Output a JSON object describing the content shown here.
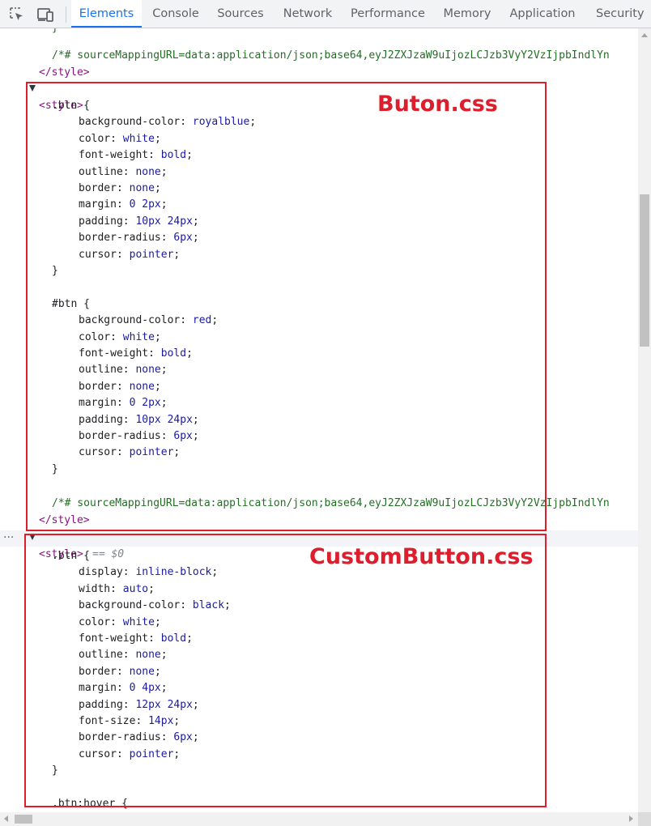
{
  "toolbar": {
    "inspect_icon": "inspect-element-icon",
    "device_icon": "device-toolbar-icon",
    "tabs": [
      {
        "label": "Elements",
        "active": true
      },
      {
        "label": "Console",
        "active": false
      },
      {
        "label": "Sources",
        "active": false
      },
      {
        "label": "Network",
        "active": false
      },
      {
        "label": "Performance",
        "active": false
      },
      {
        "label": "Memory",
        "active": false
      },
      {
        "label": "Application",
        "active": false
      },
      {
        "label": "Security",
        "active": false
      }
    ]
  },
  "tree": {
    "partial_brace": "}",
    "source_map_comment": "/*# sourceMappingURL=data:application/json;base64,eyJ2ZXJzaW9uIjozLCJzb3VyY2VzIjpbIndlYn",
    "style_open": "<style>",
    "style_close": "</style>",
    "selected_marker": "== $0",
    "style_block_1": [
      {
        "sel": ".btn {"
      },
      {
        "prop": "background-color",
        "val": "royalblue"
      },
      {
        "prop": "color",
        "val": "white"
      },
      {
        "prop": "font-weight",
        "val": "bold"
      },
      {
        "prop": "outline",
        "val": "none"
      },
      {
        "prop": "border",
        "val": "none"
      },
      {
        "prop": "margin",
        "val": "0 2px"
      },
      {
        "prop": "padding",
        "val": "10px 24px"
      },
      {
        "prop": "border-radius",
        "val": "6px"
      },
      {
        "prop": "cursor",
        "val": "pointer"
      },
      {
        "close": "}"
      },
      {
        "blank": true
      },
      {
        "sel": "#btn {"
      },
      {
        "prop": "background-color",
        "val": "red"
      },
      {
        "prop": "color",
        "val": "white"
      },
      {
        "prop": "font-weight",
        "val": "bold"
      },
      {
        "prop": "outline",
        "val": "none"
      },
      {
        "prop": "border",
        "val": "none"
      },
      {
        "prop": "margin",
        "val": "0 2px"
      },
      {
        "prop": "padding",
        "val": "10px 24px"
      },
      {
        "prop": "border-radius",
        "val": "6px"
      },
      {
        "prop": "cursor",
        "val": "pointer"
      },
      {
        "close": "}"
      },
      {
        "blank": true
      }
    ],
    "style_block_2": [
      {
        "sel": ".btn {"
      },
      {
        "prop": "display",
        "val": "inline-block"
      },
      {
        "prop": "width",
        "val": "auto"
      },
      {
        "prop": "background-color",
        "val": "black"
      },
      {
        "prop": "color",
        "val": "white"
      },
      {
        "prop": "font-weight",
        "val": "bold"
      },
      {
        "prop": "outline",
        "val": "none"
      },
      {
        "prop": "border",
        "val": "none"
      },
      {
        "prop": "margin",
        "val": "0 4px"
      },
      {
        "prop": "padding",
        "val": "12px 24px"
      },
      {
        "prop": "font-size",
        "val": "14px"
      },
      {
        "prop": "border-radius",
        "val": "6px"
      },
      {
        "prop": "cursor",
        "val": "pointer"
      },
      {
        "close": "}"
      },
      {
        "blank": true
      },
      {
        "sel": ".btn:hover {"
      }
    ]
  },
  "annotations": {
    "box1_label": "Buton.css",
    "box2_label": "CustomButton.css",
    "color": "#dc1e2d"
  },
  "colors": {
    "tag": "#881280",
    "comment": "#236e25",
    "value": "#1a1aa6",
    "active_tab": "#1a73e8"
  }
}
